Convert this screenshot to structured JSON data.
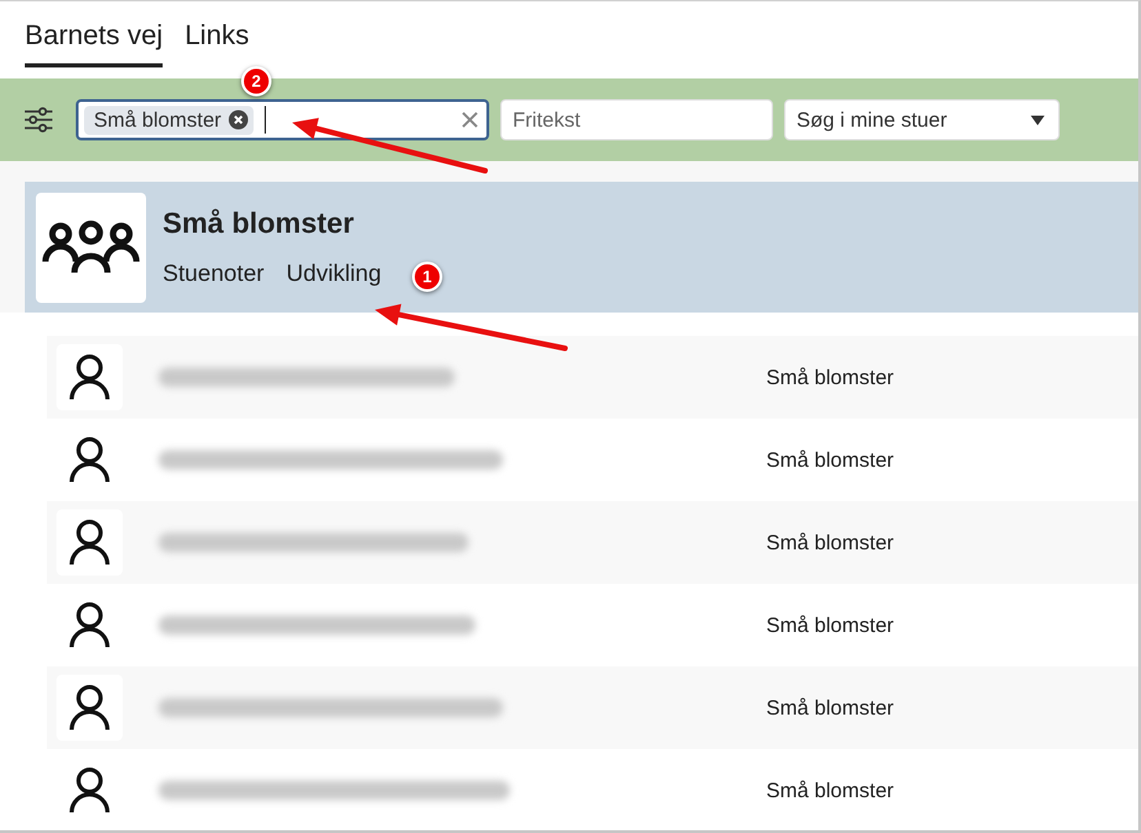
{
  "tabs": [
    {
      "label": "Barnets vej",
      "selected": true
    },
    {
      "label": "Links",
      "selected": false
    }
  ],
  "filter_bar": {
    "chip": "Små blomster",
    "search": {
      "placeholder": "Fritekst"
    },
    "scope_select": {
      "value": "Søg i mine stuer"
    }
  },
  "group": {
    "title": "Små blomster",
    "links": [
      "Stuenoter",
      "Udvikling"
    ]
  },
  "children": [
    {
      "room": "Små blomster"
    },
    {
      "room": "Små blomster"
    },
    {
      "room": "Små blomster"
    },
    {
      "room": "Små blomster"
    },
    {
      "room": "Små blomster"
    },
    {
      "room": "Små blomster"
    }
  ],
  "annotations": [
    {
      "number": "2"
    },
    {
      "number": "1"
    }
  ]
}
